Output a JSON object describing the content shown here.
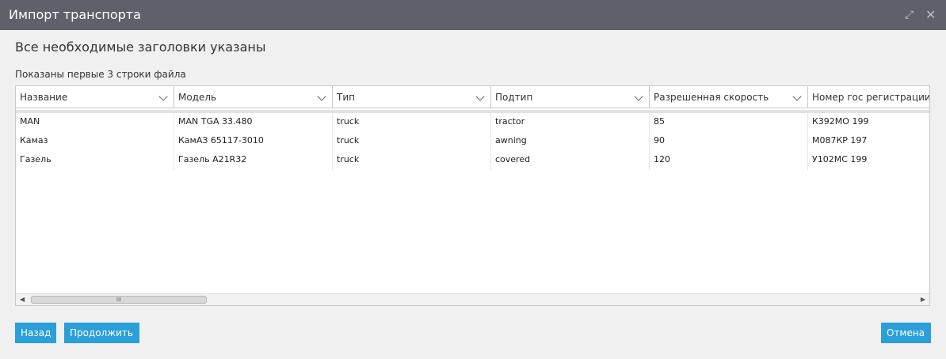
{
  "window": {
    "title": "Импорт транспорта",
    "maximize_icon": "⤢",
    "close_icon": "✕"
  },
  "heading": "Все необходимые заголовки указаны",
  "subheading": "Показаны первые 3 строки файла",
  "table": {
    "columns": [
      "Название",
      "Модель",
      "Тип",
      "Подтип",
      "Разрешенная скорость",
      "Номер гос регистрации"
    ],
    "rows": [
      [
        "MAN",
        "MAN TGA 33.480",
        "truck",
        "tractor",
        "85",
        "К392МО 199"
      ],
      [
        "Камаз",
        "КамАЗ 65117-3010",
        "truck",
        "awning",
        "90",
        "М087КР 197"
      ],
      [
        "Газель",
        "Газель A21R32",
        "truck",
        "covered",
        "120",
        "У102МС 199"
      ]
    ]
  },
  "scrollbar": {
    "left_arrow": "◀",
    "right_arrow": "▶",
    "grip": "III"
  },
  "buttons": {
    "back": "Назад",
    "continue": "Продолжить",
    "cancel": "Отмена"
  },
  "colors": {
    "titlebar": "#5f6069",
    "button": "#2b9fd9",
    "background": "#f0f0f0"
  }
}
